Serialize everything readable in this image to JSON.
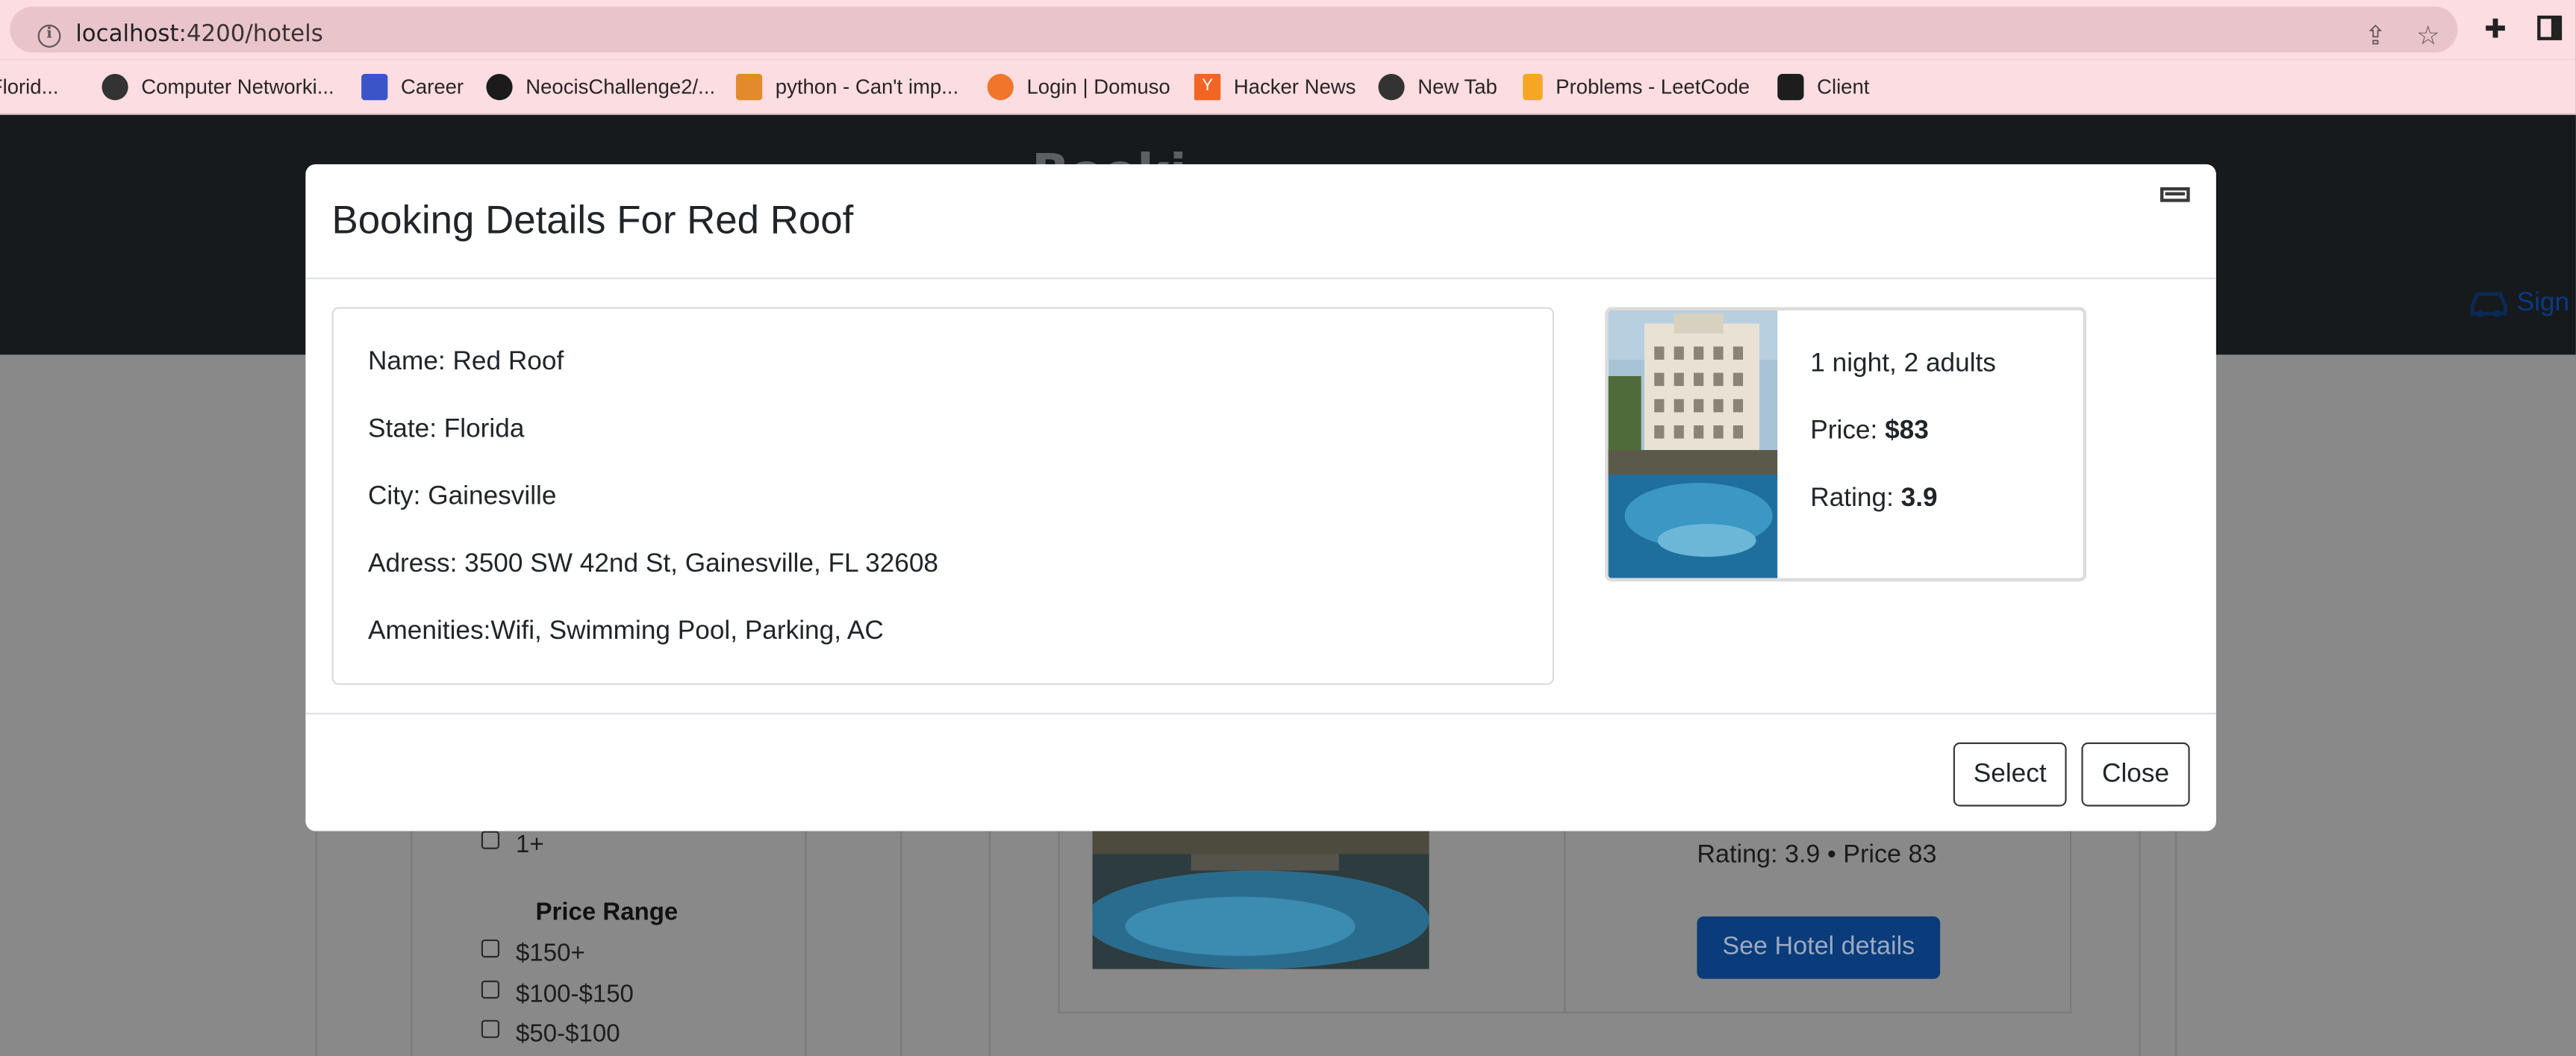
{
  "browser": {
    "url_host": "localhost",
    "url_path": ":4200/hotels",
    "bookmarks": [
      {
        "label": "Florid...",
        "icon": "bookmark-favicon"
      },
      {
        "label": "Computer Networki...",
        "icon": "globe-icon"
      },
      {
        "label": "Career",
        "icon": "career-favicon"
      },
      {
        "label": "NeocisChallenge2/...",
        "icon": "github-icon"
      },
      {
        "label": "python - Can't imp...",
        "icon": "stackoverflow-icon"
      },
      {
        "label": "Login | Domuso",
        "icon": "domuso-icon"
      },
      {
        "label": "Hacker News",
        "icon": "hackernews-icon"
      },
      {
        "label": "New Tab",
        "icon": "globe-icon"
      },
      {
        "label": "Problems - LeetCode",
        "icon": "leetcode-icon"
      },
      {
        "label": "Client",
        "icon": "angular-icon"
      }
    ]
  },
  "page": {
    "nav_title": "Booki",
    "sign_label": "Sign",
    "filters": {
      "rating_option": "1+",
      "price_heading": "Price Range",
      "price_options": [
        "$150+",
        "$100-$150",
        "$50-$100"
      ]
    },
    "hotel_card": {
      "summary": "Rating: 3.9 • Price 83",
      "details_button": "See Hotel details"
    }
  },
  "modal": {
    "title": "Booking Details For Red Roof",
    "details": {
      "name": "Name: Red Roof",
      "state": "State: Florida",
      "city": "City: Gainesville",
      "address": "Adress: 3500 SW 42nd St, Gainesville, FL 32608",
      "amenities": "Amenities:Wifi, Swimming Pool, Parking, AC"
    },
    "booking": {
      "guests": "1 night, 2 adults",
      "price_label": "Price: ",
      "price_value": "$83",
      "rating_label": "Rating: ",
      "rating_value": "3.9"
    },
    "select_button": "Select",
    "close_button": "Close"
  },
  "colors": {
    "browser_bar": "#fbdde2",
    "navbar": "#161a1d",
    "backdrop": "#898989",
    "primary_button": "#0a3b7a"
  }
}
